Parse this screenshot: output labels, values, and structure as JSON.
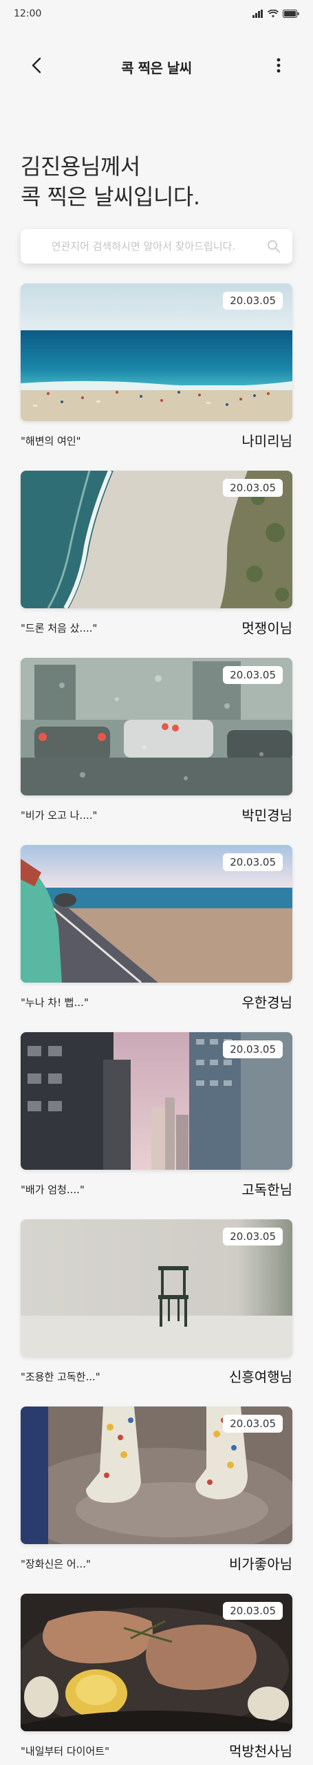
{
  "status": {
    "time": "12:00"
  },
  "header": {
    "title": "콕 찍은 날씨"
  },
  "headline": {
    "line1": "김진용님께서",
    "line2": "콕 찍은 날씨입니다."
  },
  "search": {
    "placeholder": "연관지어 검색하시면 알아서 찾아드립니다."
  },
  "posts": [
    {
      "date": "20.03.05",
      "caption": "\"해변의 여인\"",
      "author": "나미리님",
      "scene": "beach"
    },
    {
      "date": "20.03.05",
      "caption": "\"드론 처음 샀....\"",
      "author": "멋쟁이님",
      "scene": "aerial-coast"
    },
    {
      "date": "20.03.05",
      "caption": "\"비가 오고 나....\"",
      "author": "박민경님",
      "scene": "rainy-window"
    },
    {
      "date": "20.03.05",
      "caption": "\"누나 차! 뻡...\"",
      "author": "우한경님",
      "scene": "car-coast"
    },
    {
      "date": "20.03.05",
      "caption": "\"배가 엄청....\"",
      "author": "고독한님",
      "scene": "city"
    },
    {
      "date": "20.03.05",
      "caption": "\"조용한 고독한...\"",
      "author": "신흥여행님",
      "scene": "chair"
    },
    {
      "date": "20.03.05",
      "caption": "\"장화신은 어...\"",
      "author": "비가좋아님",
      "scene": "rain-boots"
    },
    {
      "date": "20.03.05",
      "caption": "\"내일부터 다이어트\"",
      "author": "먹방천사님",
      "scene": "food"
    }
  ]
}
